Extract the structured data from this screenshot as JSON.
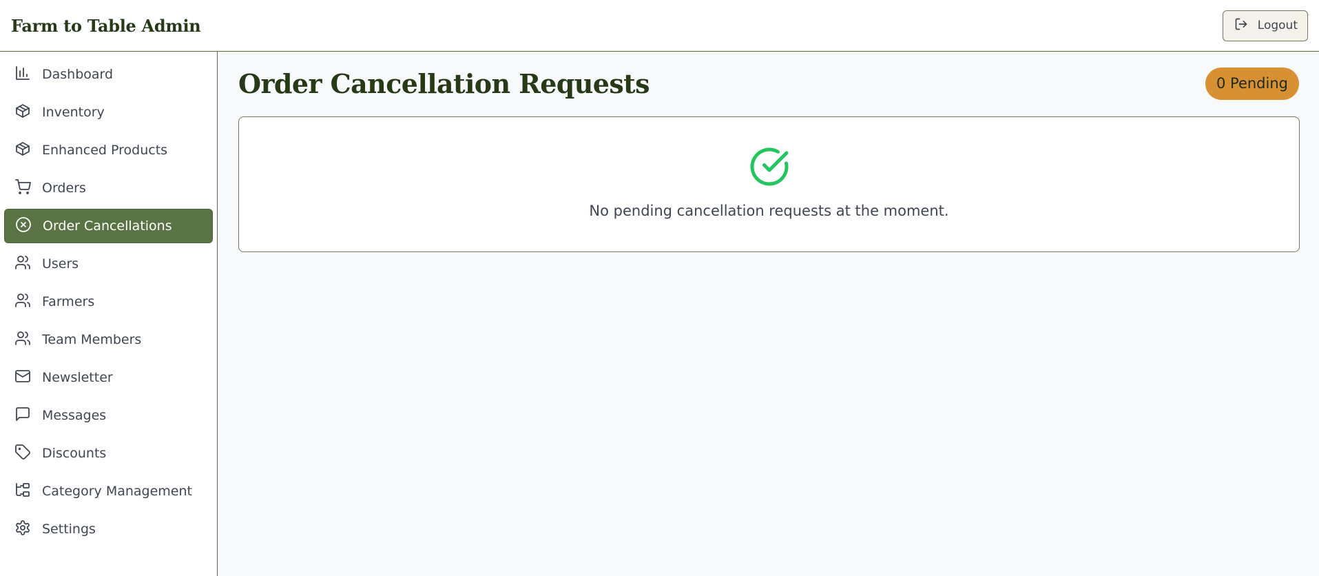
{
  "header": {
    "brand": "Farm to Table Admin",
    "logout_label": "Logout"
  },
  "sidebar": {
    "items": [
      {
        "label": "Dashboard",
        "icon": "bar-chart-icon"
      },
      {
        "label": "Inventory",
        "icon": "package-icon"
      },
      {
        "label": "Enhanced Products",
        "icon": "package-icon"
      },
      {
        "label": "Orders",
        "icon": "cart-icon"
      },
      {
        "label": "Order Cancellations",
        "icon": "x-circle-icon",
        "active": true
      },
      {
        "label": "Users",
        "icon": "users-icon"
      },
      {
        "label": "Farmers",
        "icon": "users-icon"
      },
      {
        "label": "Team Members",
        "icon": "users-icon"
      },
      {
        "label": "Newsletter",
        "icon": "mail-icon"
      },
      {
        "label": "Messages",
        "icon": "message-square-icon"
      },
      {
        "label": "Discounts",
        "icon": "tag-icon"
      },
      {
        "label": "Category Management",
        "icon": "folder-tree-icon"
      },
      {
        "label": "Settings",
        "icon": "settings-icon"
      }
    ]
  },
  "main": {
    "title": "Order Cancellation Requests",
    "pending_badge": "0 Pending",
    "empty_icon": "check-circle-icon",
    "empty_message": "No pending cancellation requests at the moment."
  },
  "colors": {
    "brand_dark": "#263a17",
    "active_nav": "#5a7345",
    "badge": "#d79133",
    "success": "#22c55e"
  }
}
